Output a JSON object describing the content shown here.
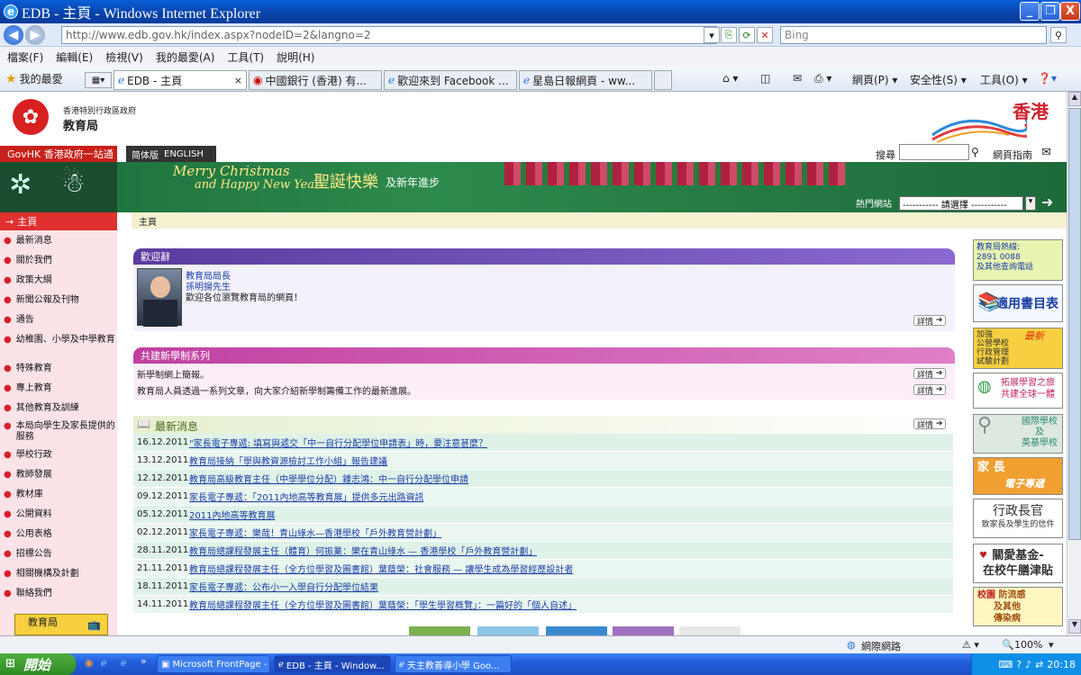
{
  "window": {
    "title": "EDB - 主頁 - Windows Internet Explorer",
    "min": "_",
    "max": "❐",
    "close": "X"
  },
  "address": {
    "url": "http://www.edb.gov.hk/index.aspx?nodeID=2&langno=2",
    "search_placeholder": "Bing"
  },
  "menu": [
    "檔案(F)",
    "編輯(E)",
    "檢視(V)",
    "我的最愛(A)",
    "工具(T)",
    "說明(H)"
  ],
  "favorites": {
    "label": "我的最愛"
  },
  "tabs": [
    {
      "label": "EDB - 主頁"
    },
    {
      "label": "中國銀行 (香港) 有..."
    },
    {
      "label": "歡迎來到 Facebook ..."
    },
    {
      "label": "星島日報網頁 - ww..."
    }
  ],
  "commands": {
    "page": "網頁(P) ▾",
    "safety": "安全性(S) ▾",
    "tools": "工具(O) ▾",
    "help": "❓▾"
  },
  "header": {
    "gov_name": "香港特別行政區政府",
    "dept_name": "教育局",
    "brand": "香港",
    "govhk": "GovHK 香港政府一站通",
    "lang_simplified": "简体版",
    "lang_english": "ENGLISH",
    "search_label": "搜尋",
    "sitemap": "網頁指南",
    "banner_title": "Merry Christmas",
    "banner_sub": "and Happy New Year",
    "banner_cn": "聖誕快樂",
    "banner_cn2": "及新年進步",
    "hot_label": "熱門網站",
    "hot_select": "----------- 請選擇 -----------"
  },
  "breadcrumb": "主頁",
  "leftnav": {
    "home": "主頁",
    "items": [
      "最新消息",
      "關於我們",
      "政策大綱",
      "新聞公報及刊物",
      "通告",
      "幼稚園、小學及中學教育",
      "特殊教育",
      "專上教育",
      "其他教育及訓練",
      "本局向學生及家長提供的服務",
      "學校行政",
      "教師發展",
      "教材庫",
      "公開資料",
      "公用表格",
      "招標公告",
      "相關機構及計劃",
      "聯絡我們"
    ],
    "youtube": "教育局",
    "youtube2": "YouTube"
  },
  "welcome": {
    "title": "歡迎辭",
    "role": "教育局局長",
    "name": "孫明揚先生",
    "text": "歡迎各位瀏覽教育局的網頁！",
    "details": "詳情"
  },
  "nss": {
    "title": "共建新學制系列",
    "line1": "新學制網上簡報。",
    "line2": "教育局人員透過一系列文章，向大家介紹新學制籌備工作的最新進展。",
    "details": "詳情"
  },
  "news": {
    "title": "最新消息",
    "details": "詳情",
    "items": [
      {
        "date": "16.12.2011",
        "text": "\"家長電子專遞: 填寫與遞交「中一自行分配學位申請表」時，要注意甚麼？"
      },
      {
        "date": "13.12.2011",
        "text": "教育局接納「學與教資源檢討工作小組」報告建議"
      },
      {
        "date": "12.12.2011",
        "text": "教育局高級教育主任（中學學位分配）鍾志鴻：中一自行分配學位申請"
      },
      {
        "date": "09.12.2011",
        "text": "家長電子專遞：「2011內地高等教育展」提供多元出路資訊"
      },
      {
        "date": "05.12.2011",
        "text": "2011內地高等教育展"
      },
      {
        "date": "02.12.2011",
        "text": "家長電子專遞：樂哉！青山綠水—香港學校「戶外教育營計劃」"
      },
      {
        "date": "28.11.2011",
        "text": "教育局總課程發展主任（體育）何振業：樂在青山綠水 — 香港學校「戶外教育營計劃」"
      },
      {
        "date": "21.11.2011",
        "text": "教育局總課程發展主任（全方位學習及圖書館）葉蔭榮：社會服務 — 讓學生成為學習經歷設計者"
      },
      {
        "date": "18.11.2011",
        "text": "家長電子專遞：公布小一入學自行分配學位結果"
      },
      {
        "date": "14.11.2011",
        "text": "教育局總課程發展主任（全方位學習及圖書館）葉蔭榮：「學生學習概覽」：一篇好的「個人自述」"
      }
    ]
  },
  "right": {
    "hotline1": "教育局熱線:",
    "hotline2": "2891 0088",
    "hotline3": "及其他查詢電話",
    "booklist": "適用書目表",
    "pilot1": "加強",
    "pilot2": "公營學校",
    "pilot3": "行政管理",
    "pilot4": "試驗計劃",
    "pilot_new": "最新",
    "global1": "拓展學習之旅",
    "global2": "共建全球一體",
    "intl1": "國際學校",
    "intl2": "及",
    "intl3": "英基學校",
    "parent1": "家 長",
    "parent2": "電子專遞",
    "ce1": "行政長官",
    "ce2": "致家長及學生的信件",
    "fund1": "關愛基金-",
    "fund2": "在校午膳津貼",
    "flu1": "校園",
    "flu2": "防流感",
    "flu3": "及其他",
    "flu4": "傳染病"
  },
  "status": {
    "zone": "網際網路",
    "zoom": "100%"
  },
  "taskbar": {
    "start": "開始",
    "tasks": [
      "Microsoft FrontPage - ...",
      "EDB - 主頁 - Window...",
      "天主教善導小學 Goo..."
    ],
    "time": "20:18"
  }
}
